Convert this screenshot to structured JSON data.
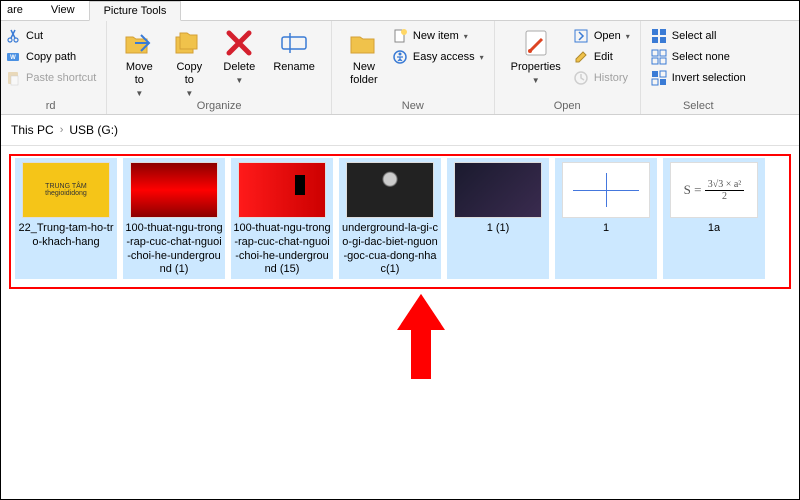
{
  "tabs": {
    "share": "are",
    "view": "View",
    "picture_tools": "Picture Tools"
  },
  "ribbon": {
    "clipboard": {
      "title": "rd",
      "cut": "Cut",
      "copy_path": "Copy path",
      "paste_shortcut": "Paste shortcut"
    },
    "organize": {
      "title": "Organize",
      "move_to": "Move\nto",
      "copy_to": "Copy\nto",
      "delete": "Delete",
      "rename": "Rename"
    },
    "new": {
      "title": "New",
      "new_folder": "New\nfolder",
      "new_item": "New item",
      "easy_access": "Easy access"
    },
    "open": {
      "title": "Open",
      "properties": "Properties",
      "open": "Open",
      "edit": "Edit",
      "history": "History"
    },
    "select": {
      "title": "Select",
      "select_all": "Select all",
      "select_none": "Select none",
      "invert_selection": "Invert selection"
    }
  },
  "breadcrumb": {
    "this_pc": "This PC",
    "usb": "USB (G:)"
  },
  "files": [
    {
      "name": "22_Trung-tam-ho-tro-khach-hang",
      "thumb": "banner",
      "selected": true
    },
    {
      "name": "100-thuat-ngu-trong-rap-cuc-chat-nguoi-choi-he-underground (1)",
      "thumb": "rap1",
      "selected": true
    },
    {
      "name": "100-thuat-ngu-trong-rap-cuc-chat-nguoi-choi-he-underground (15)",
      "thumb": "rap2",
      "selected": true
    },
    {
      "name": "underground-la-gi-co-gi-dac-biet-nguon-goc-cua-dong-nhac(1)",
      "thumb": "crowd",
      "selected": true
    },
    {
      "name": "1 (1)",
      "thumb": "dark",
      "selected": true
    },
    {
      "name": "1",
      "thumb": "axis",
      "selected": true
    },
    {
      "name": "1a",
      "thumb": "formula",
      "selected": true
    }
  ],
  "formula_tex": "S = (3√3 × a²) / 2"
}
